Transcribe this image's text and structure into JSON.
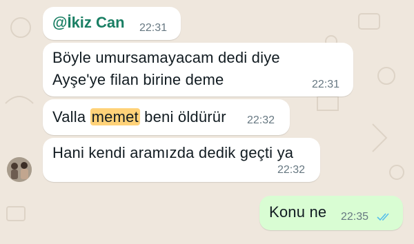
{
  "colors": {
    "background": "#efe7dd",
    "incoming_bubble": "#ffffff",
    "outgoing_bubble": "#d9fdd3",
    "mention": "#1a7f64",
    "highlight": "#ffd279",
    "read_ticks": "#53bdeb"
  },
  "messages": [
    {
      "sender_mention": "@İkiz Can",
      "time": "22:31"
    },
    {
      "line1": "Böyle umursamayacam dedi diye",
      "line2": "Ayşe'ye filan birine deme",
      "time": "22:31"
    },
    {
      "before": "Valla ",
      "highlight": "memet",
      "after": " beni öldürür",
      "time": "22:32"
    },
    {
      "text": "Hani kendi aramızda dedik geçti ya",
      "time": "22:32"
    },
    {
      "text": "Konu ne",
      "time": "22:35",
      "status_icon": "double-check-read-icon"
    }
  ],
  "avatar_icon": "group-avatar"
}
